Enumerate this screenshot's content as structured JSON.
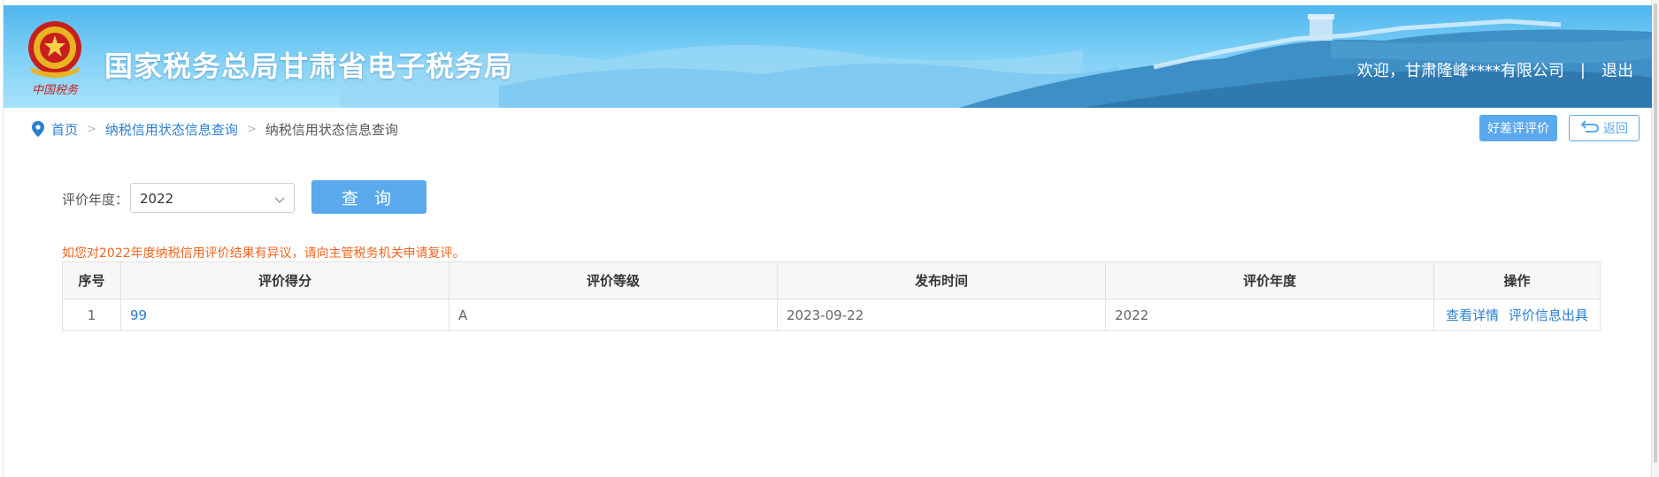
{
  "header": {
    "site_title": "国家税务总局甘肃省电子税务局",
    "welcome_text": "欢迎，甘肃隆峰****有限公司",
    "separator": "|",
    "logout_label": "退出",
    "emblem_text": "中国税务"
  },
  "breadcrumb": {
    "items": [
      "首页",
      "纳税信用状态信息查询",
      "纳税信用状态信息查询"
    ],
    "separator": ">"
  },
  "toolbar": {
    "review_label": "好差评评价",
    "back_label": "返回"
  },
  "query": {
    "year_label": "评价年度：",
    "year_value": "2022",
    "query_button": "查 询"
  },
  "notice": "如您对2022年度纳税信用评价结果有异议，请向主管税务机关申请复评。",
  "table": {
    "columns": [
      "序号",
      "评价得分",
      "评价等级",
      "发布时间",
      "评价年度",
      "操作"
    ],
    "rows": [
      {
        "index": "1",
        "score": "99",
        "grade": "A",
        "publish_date": "2023-09-22",
        "year": "2022",
        "actions": [
          "查看详情",
          "评价信息出具"
        ]
      }
    ]
  },
  "colors": {
    "accent": "#5aa9ec",
    "link": "#2b7fd0",
    "notice": "#f0641e",
    "header_sky": "#4fb6ee"
  }
}
